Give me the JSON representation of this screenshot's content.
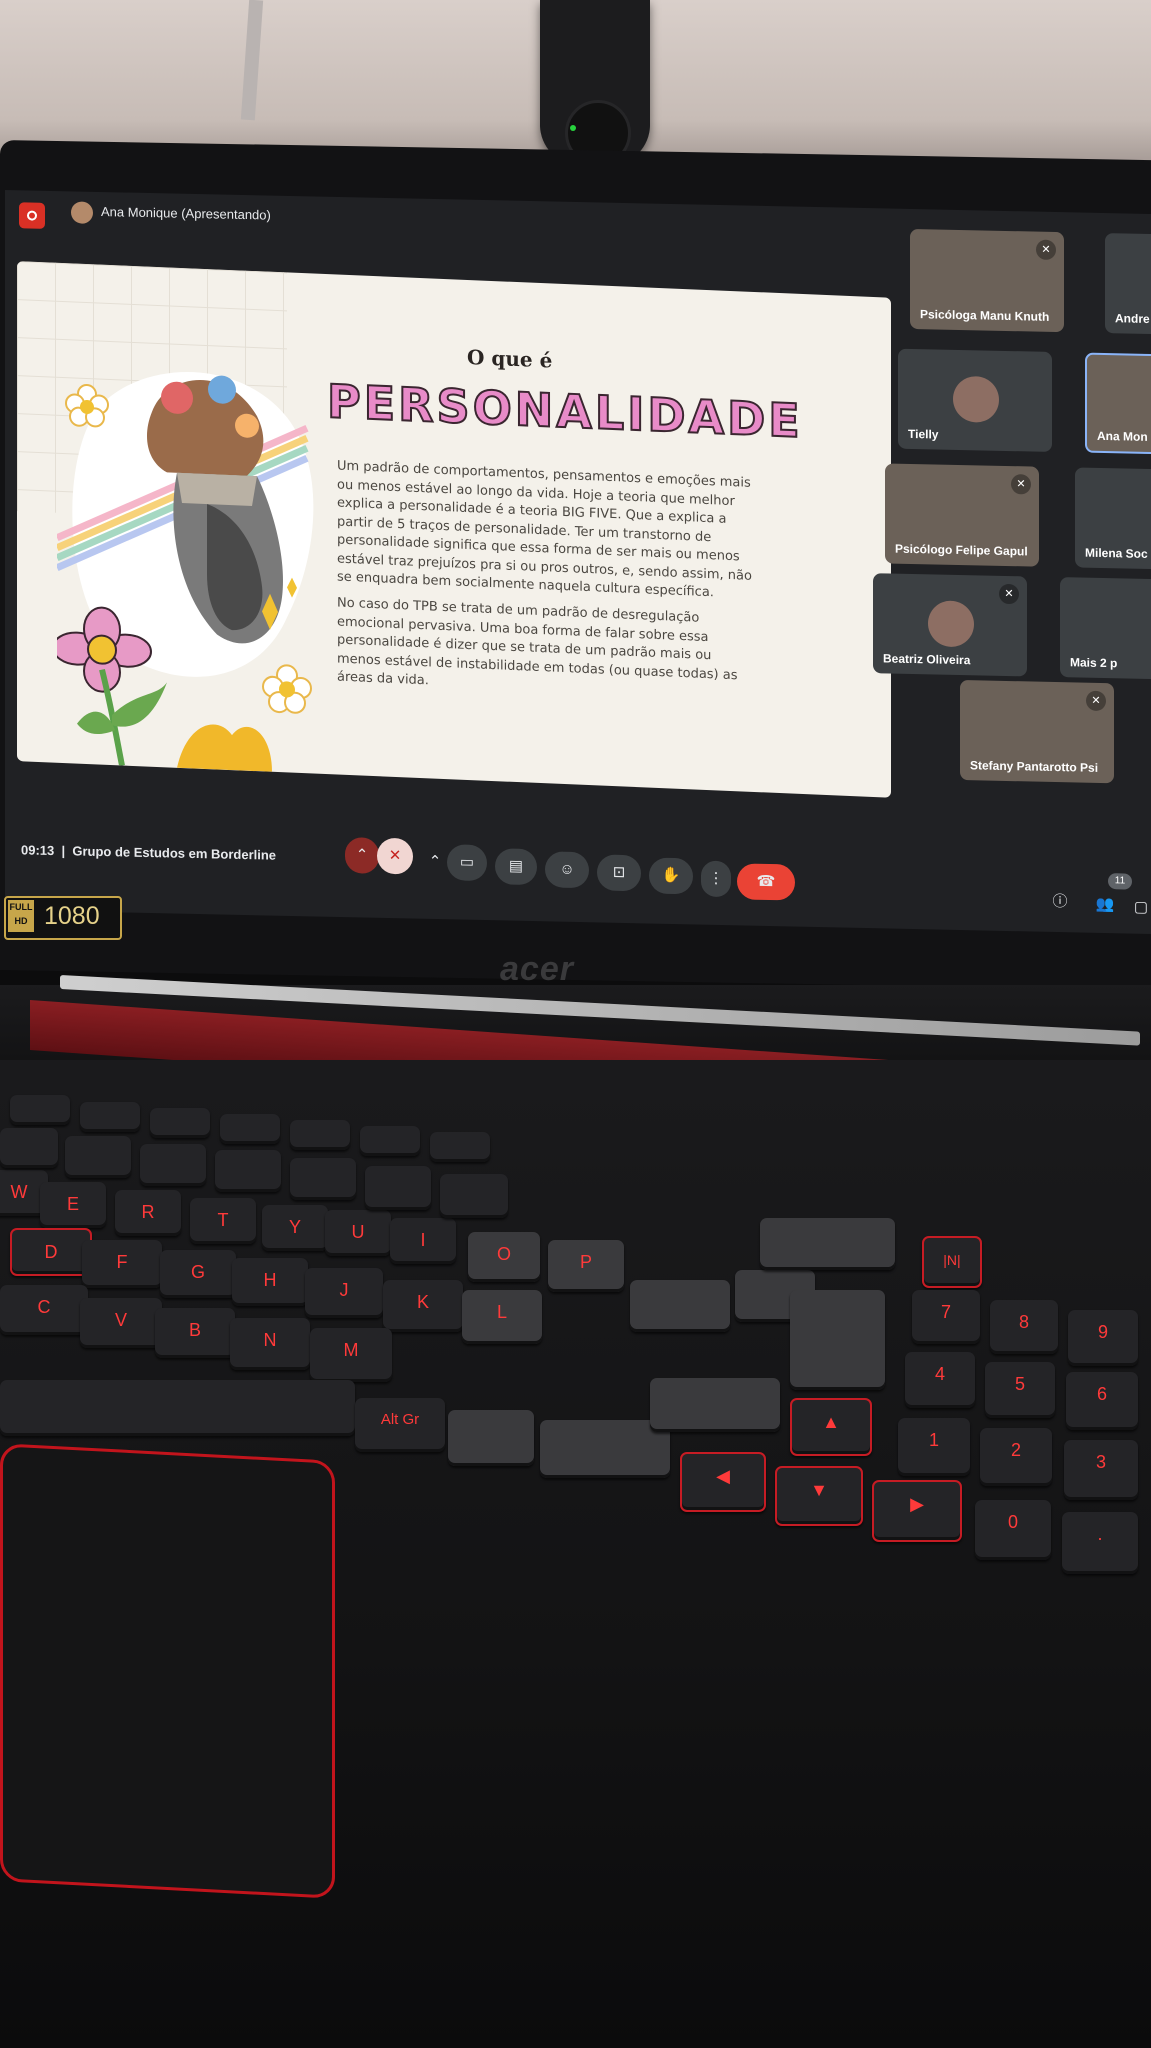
{
  "meet": {
    "presenter_label": "Ana Monique (Apresentando)",
    "meeting_time": "09:13",
    "meeting_name": "Grupo de Estudos em Borderline",
    "participant_count": "11"
  },
  "slide": {
    "subtitle": "O que é",
    "title": "PERSONALIDADE",
    "paragraph1": "Um padrão de comportamentos, pensamentos e emoções mais ou menos estável ao longo da vida. Hoje a teoria que melhor explica a personalidade é a teoria BIG FIVE. Que a explica a partir de 5 traços de personalidade. Ter um transtorno de personalidade significa que essa forma de ser mais ou menos estável traz prejuízos pra si ou pros outros, e, sendo assim, não se enquadra bem socialmente naquela cultura específica.",
    "paragraph2": "No caso do TPB se trata de um padrão de desregulação emocional pervasiva. Uma boa forma de falar sobre essa personalidade é dizer que se trata de um padrão mais ou menos estável de instabilidade em todas (ou quase todas) as áreas da vida."
  },
  "participants": [
    {
      "name": "Psicóloga Manu Knuth",
      "muted": true,
      "video": true
    },
    {
      "name": "Andre",
      "muted": false,
      "video": false
    },
    {
      "name": "Tielly",
      "muted": false,
      "video": false
    },
    {
      "name": "Ana Mon",
      "muted": false,
      "video": true
    },
    {
      "name": "Psicólogo Felipe Gapul",
      "muted": true,
      "video": true
    },
    {
      "name": "Milena Soc",
      "muted": false,
      "video": false
    },
    {
      "name": "Beatriz Oliveira",
      "muted": true,
      "video": false
    },
    {
      "name": "Mais 2 p",
      "muted": false,
      "video": false
    },
    {
      "name": "Stefany Pantarotto Psi",
      "muted": true,
      "video": true
    }
  ],
  "badge": {
    "full": "FULL",
    "hd": "HD",
    "resolution": "1080"
  },
  "laptop_brand": "acer",
  "keys": {
    "row1": [
      "W",
      "E",
      "R",
      "T",
      "Y",
      "U",
      "I",
      "O",
      "P"
    ],
    "row2": [
      "D",
      "F",
      "G",
      "H",
      "J",
      "K",
      "L"
    ],
    "row3": [
      "C",
      "V",
      "B",
      "N",
      "M"
    ],
    "altgr": "Alt Gr",
    "numpad": [
      "7",
      "8",
      "9",
      "4",
      "5",
      "6",
      "1",
      "2",
      "3",
      "0"
    ]
  },
  "icons": {
    "record": "record-icon",
    "mic": "mic-off-icon",
    "camera": "camera-icon",
    "captions": "captions-icon",
    "emoji": "emoji-icon",
    "present": "present-screen-icon",
    "hand": "raise-hand-icon",
    "more": "more-vert-icon",
    "end": "end-call-icon",
    "info": "info-icon",
    "people": "people-icon",
    "chat": "chat-icon"
  },
  "colors": {
    "end_call": "#ea4335",
    "title_pink": "#e88bc8",
    "keyboard_red": "#ff3a3a"
  }
}
